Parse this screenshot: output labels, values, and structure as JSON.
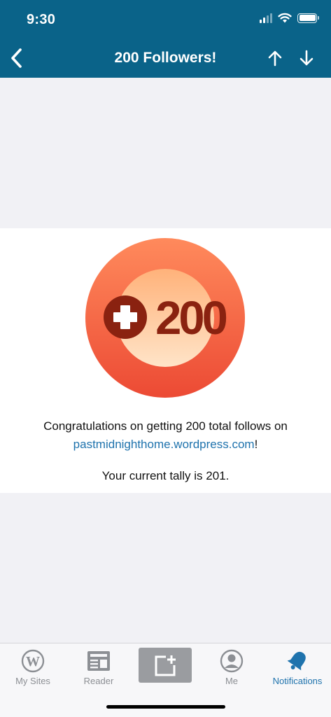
{
  "status": {
    "time": "9:30"
  },
  "nav": {
    "title": "200 Followers!",
    "back_icon": "chevron-left-icon",
    "up_icon": "arrow-up-icon",
    "down_icon": "arrow-down-icon"
  },
  "badge": {
    "text": "200",
    "icon": "plus-circle-icon"
  },
  "message": {
    "prefix": "Congratulations on getting 200 total follows on",
    "site": "pastmidnighthome.wordpress.com",
    "suffix": "!",
    "tally": "Your current tally is 201."
  },
  "tabs": [
    {
      "label": "My Sites",
      "icon": "wordpress-icon"
    },
    {
      "label": "Reader",
      "icon": "reader-icon"
    },
    {
      "label": "",
      "icon": "new-post-icon"
    },
    {
      "label": "Me",
      "icon": "person-icon"
    },
    {
      "label": "Notifications",
      "icon": "bell-icon"
    }
  ],
  "colors": {
    "header_bg": "#0a6389",
    "link": "#1f73ad",
    "active_tab": "#1f73ad",
    "badge_outer": "#f2623f",
    "badge_inner": "#ffd1a3"
  }
}
